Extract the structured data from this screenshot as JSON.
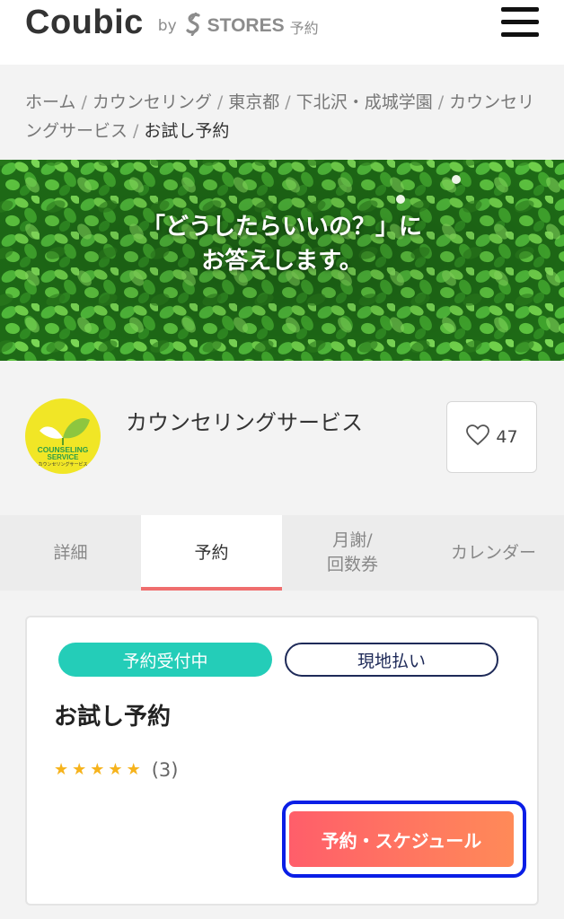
{
  "header": {
    "logo": "Coubic",
    "by": "by",
    "stores_brand": "STORES",
    "stores_suffix": "予約",
    "menu_icon": "hamburger-menu-icon"
  },
  "breadcrumb": {
    "items": [
      "ホーム",
      "カウンセリング",
      "東京都",
      "下北沢・成城学園",
      "カウンセリングサービス"
    ],
    "separator": "/",
    "current": "お試し予約"
  },
  "banner": {
    "line1": "「どうしたらいいの？」に",
    "line2": "お答えします。"
  },
  "shop": {
    "name": "カウンセリングサービス",
    "logo_text_line1": "COUNSELING",
    "logo_text_line2": "SERVICE",
    "logo_text_line3": "カウンセリングサービス",
    "favorite_count": "47"
  },
  "tabs": [
    {
      "label": "詳細",
      "active": false
    },
    {
      "label": "予約",
      "active": true
    },
    {
      "label_line1": "月謝/",
      "label_line2": "回数券",
      "active": false
    },
    {
      "label": "カレンダー",
      "active": false
    }
  ],
  "plan": {
    "status_badge": "予約受付中",
    "payment_badge": "現地払い",
    "title": "お試し予約",
    "stars": 5,
    "review_count": "(3)",
    "book_button": "予約・スケジュール"
  },
  "colors": {
    "accent_teal": "#24cdb8",
    "navy": "#1e2a58",
    "tab_underline": "#ef6e6e",
    "button_start": "#ff5e6a",
    "button_end": "#ff8a58",
    "star": "#f6b31c",
    "focus": "#0a1ee6"
  }
}
